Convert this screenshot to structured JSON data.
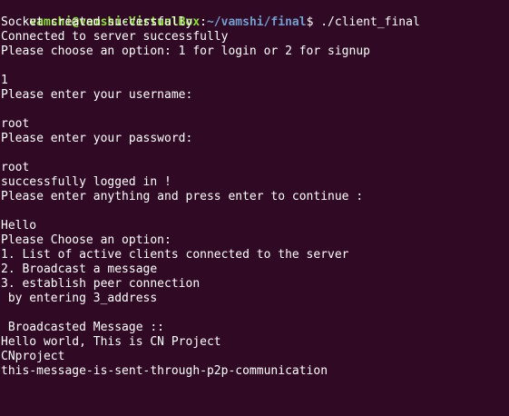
{
  "prompt": {
    "user_host": "vamshi@vamshi-VirtualBox",
    "colon": ":",
    "path": "~/vamshi/final",
    "symbol": "$ ",
    "command": "./client_final"
  },
  "output_lines": [
    "Socket created successfully",
    "Connected to server successfully",
    "Please choose an option: 1 for login or 2 for signup",
    "",
    "1",
    "Please enter your username:",
    "",
    "root",
    "Please enter your password:",
    "",
    "root",
    "successfully logged in !",
    "Please enter anything and press enter to continue :",
    "",
    "Hello",
    "Please Choose an option:",
    "1. List of active clients connected to the server",
    "2. Broadcast a message",
    "3. establish peer connection",
    " by entering 3_address",
    "",
    " Broadcasted Message ::",
    "Hello world, This is CN Project",
    "CNproject",
    "this-message-is-sent-through-p2p-communication"
  ],
  "colors": {
    "background": "#300a24",
    "text": "#ffffff",
    "user_host": "#8ae234",
    "path": "#729fcf"
  }
}
